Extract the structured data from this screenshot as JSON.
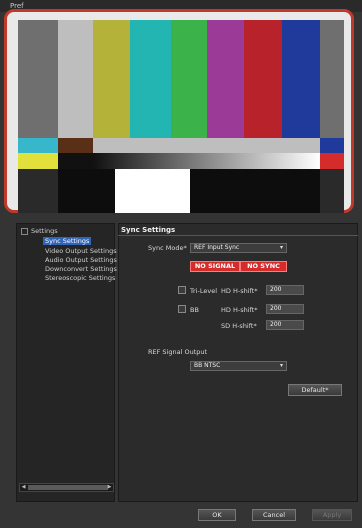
{
  "window": {
    "title": "Pref"
  },
  "preview": {
    "bars_top": [
      "#6f6f6f",
      "#bebebe",
      "#b5b23a",
      "#22b5b1",
      "#3cb34a",
      "#9c3b97",
      "#b8222b",
      "#1f3a9a",
      "#6f6f6f"
    ],
    "strip": [
      "#37b7c9",
      "#5a2f18",
      "#bebebe",
      "#bebebe",
      "#bebebe",
      "#bebebe",
      "#bebebe",
      "#bebebe",
      "#1f3a9a"
    ],
    "gradient_left": "#e2e03a",
    "gradient_right": "#d42b2b"
  },
  "tree": {
    "root": "Settings",
    "items": [
      {
        "label": "Sync Settings",
        "selected": true
      },
      {
        "label": "Video Output Settings",
        "selected": false
      },
      {
        "label": "Audio Output Settings",
        "selected": false
      },
      {
        "label": "Downconvert Settings",
        "selected": false
      },
      {
        "label": "Stereoscopic Settings",
        "selected": false
      }
    ]
  },
  "sync": {
    "title": "Sync Settings",
    "sync_mode_label": "Sync Mode*",
    "sync_mode_value": "REF Input Sync",
    "status_no_signal": "NO SIGNAL",
    "status_no_sync": "NO SYNC",
    "trilevel_label": "Tri-Level",
    "hd_hshift_label": "HD H-shift*",
    "trilevel_hd_value": "200",
    "bb_label": "BB",
    "bb_hd_label": "HD H-shift*",
    "bb_hd_value": "200",
    "bb_sd_label": "SD H-shift*",
    "bb_sd_value": "200",
    "ref_output_label": "REF Signal Output",
    "ref_output_value": "BB NTSC",
    "default_button": "Default*"
  },
  "footer": {
    "ok": "OK",
    "cancel": "Cancel",
    "apply": "Apply"
  }
}
